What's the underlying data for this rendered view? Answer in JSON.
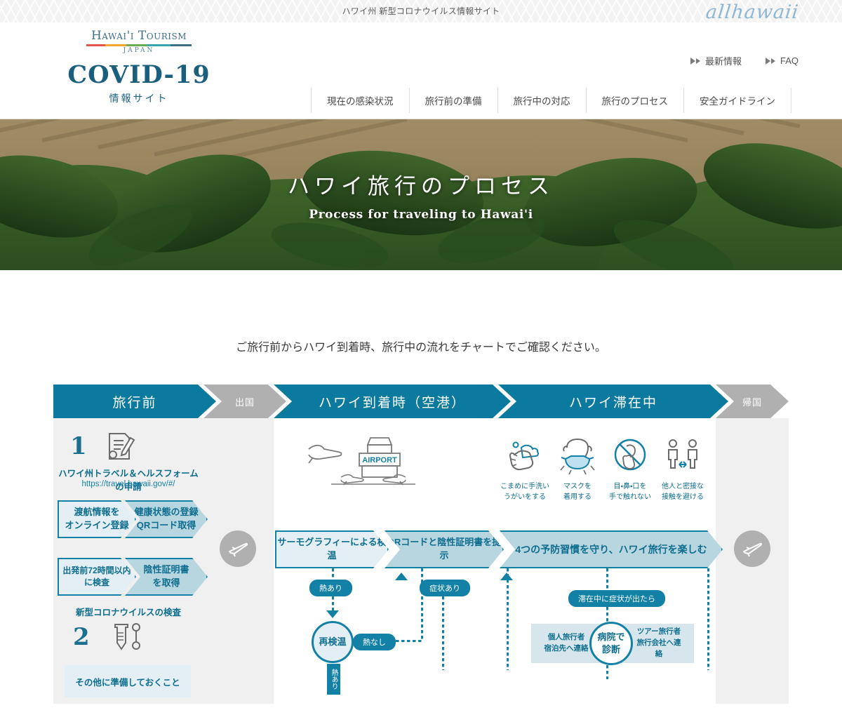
{
  "topbar": {
    "title": "ハワイ州 新型コロナウイルス情報サイト",
    "brand": "allhawaii"
  },
  "header": {
    "logo_tourism": "Hawai'i Tourism",
    "logo_japan": "JAPAN",
    "title": "COVID-19",
    "subtitle": "情報サイト",
    "util_links": [
      {
        "label": "最新情報",
        "icon": "double-triangle-icon"
      },
      {
        "label": "FAQ",
        "icon": "double-triangle-icon"
      }
    ],
    "nav": [
      {
        "label": "現在の感染状況"
      },
      {
        "label": "旅行前の準備"
      },
      {
        "label": "旅行中の対応"
      },
      {
        "label": "旅行のプロセス"
      },
      {
        "label": "安全ガイドライン"
      }
    ]
  },
  "hero": {
    "title_jp": "ハワイ旅行のプロセス",
    "title_en": "Process for traveling to Hawai'i"
  },
  "intro": {
    "text": "ご旅行前からハワイ到着時、旅行中の流れをチャートでご確認ください。"
  },
  "chart": {
    "stages": [
      {
        "label": "旅行前",
        "type": "teal"
      },
      {
        "label": "出国",
        "type": "gray"
      },
      {
        "label": "ハワイ到着時（空港）",
        "type": "teal"
      },
      {
        "label": "ハワイ滞在中",
        "type": "teal"
      },
      {
        "label": "帰国",
        "type": "gray"
      }
    ],
    "pre_travel": {
      "step1_number": "1",
      "step1_icon": "document-pen-icon",
      "step1_caption": "ハワイ州トラベル＆ヘルスフォームの申請",
      "step1_url": "https://travel.hawaii.gov/#/",
      "row1": [
        {
          "label_line1": "渡航情報を",
          "label_line2": "オンライン登録"
        },
        {
          "label_line1": "健康状態の登録",
          "label_line2": "QRコード取得"
        }
      ],
      "row2": [
        {
          "label_line1": "出発前72時間以内",
          "label_line2": "に検査"
        },
        {
          "label_line1": "陰性証明書",
          "label_line2": "を取得"
        }
      ],
      "step2_caption": "新型コロナウイルスの検査",
      "step2_number": "2",
      "step2_icon": "test-tube-swab-icon",
      "other_box": "その他に準備しておくこと"
    },
    "departure": {
      "icon": "airplane-departure-icon"
    },
    "return": {
      "icon": "airplane-departure-icon"
    },
    "arrival": {
      "icon": "airport-terminal-icon",
      "icon_label": "AIRPORT",
      "steps": [
        {
          "label": "サーモグラフィーによる検温",
          "tone": "lite"
        },
        {
          "label": "QRコードと陰性証明書を提示",
          "tone": "mid"
        }
      ],
      "pill_fever": "熱あり",
      "pill_symptom": "症状あり",
      "recheck_node": "再検温",
      "pill_no_fever": "熱なし",
      "vertical_fever": "熱あり"
    },
    "staying": {
      "habits": [
        {
          "icon": "hand-wash-icon",
          "line1": "こまめに手洗い",
          "line2": "うがいをする"
        },
        {
          "icon": "face-mask-icon",
          "line1": "マスクを",
          "line2": "着用する"
        },
        {
          "icon": "no-face-touch-icon",
          "line1": "目・鼻・口を",
          "line2": "手で触れない"
        },
        {
          "icon": "social-distance-icon",
          "line1": "他人と密接な",
          "line2": "接触を避ける"
        }
      ],
      "step": {
        "label": "4つの予防習慣を守り、ハワイ旅行を楽しむ",
        "tone": "mid"
      },
      "pill_symptom_during": "滞在中に症状が出たら",
      "hospital_left_line1": "個人旅行者",
      "hospital_left_line2": "宿泊先へ連絡",
      "hospital_node_line1": "病院で",
      "hospital_node_line2": "診断",
      "hospital_right_line1": "ツアー旅行者",
      "hospital_right_line2": "旅行会社へ連絡"
    }
  },
  "colors": {
    "teal": "#0b7a9e",
    "teal_border": "#1380a6",
    "teal_text": "#0f6e8f",
    "lite_fill": "#e3eff4",
    "mid_fill": "#b8d6e0",
    "gray_stage": "#b0b0b0",
    "band_gray": "#f0f0f0"
  }
}
